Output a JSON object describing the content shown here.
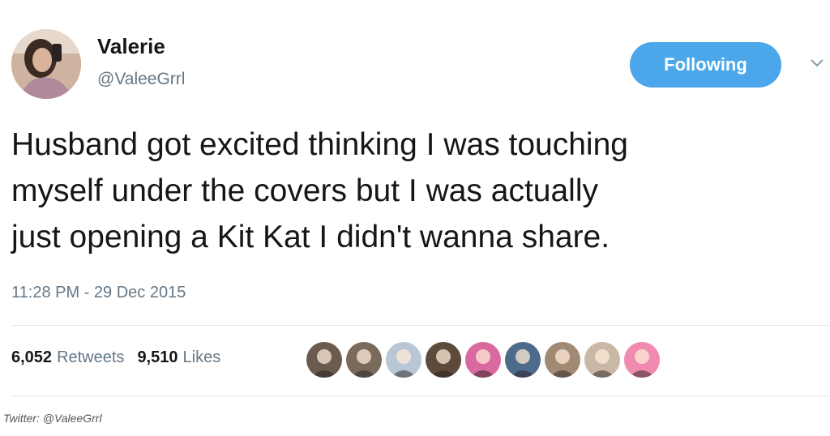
{
  "user": {
    "name": "Valerie",
    "handle": "@ValeeGrrl",
    "avatar_icon": "profile-photo"
  },
  "follow_button": {
    "label": "Following",
    "color": "#4ca7ea"
  },
  "menu_icon": "chevron-down-icon",
  "tweet": {
    "text": "Husband got excited thinking I was touching\nmyself under the covers but I was actually\njust opening a Kit Kat I didn't wanna share.",
    "timestamp": "11:28 PM - 29 Dec 2015"
  },
  "stats": {
    "retweets_count": "6,052",
    "retweets_label": "Retweets",
    "likes_count": "9,510",
    "likes_label": "Likes"
  },
  "likers": [
    {
      "icon": "liker-avatar",
      "color": "#6b5a4e"
    },
    {
      "icon": "liker-avatar",
      "color": "#7a6a5c"
    },
    {
      "icon": "liker-avatar",
      "color": "#b8c6d6"
    },
    {
      "icon": "liker-avatar",
      "color": "#5c4a3a"
    },
    {
      "icon": "liker-avatar",
      "color": "#d86aa0"
    },
    {
      "icon": "liker-avatar",
      "color": "#4d6b8a"
    },
    {
      "icon": "liker-avatar",
      "color": "#a08a74"
    },
    {
      "icon": "liker-avatar",
      "color": "#c9b8a6"
    },
    {
      "icon": "liker-avatar",
      "color": "#f08ab0"
    }
  ],
  "caption": "Twitter: @ValeeGrrl"
}
